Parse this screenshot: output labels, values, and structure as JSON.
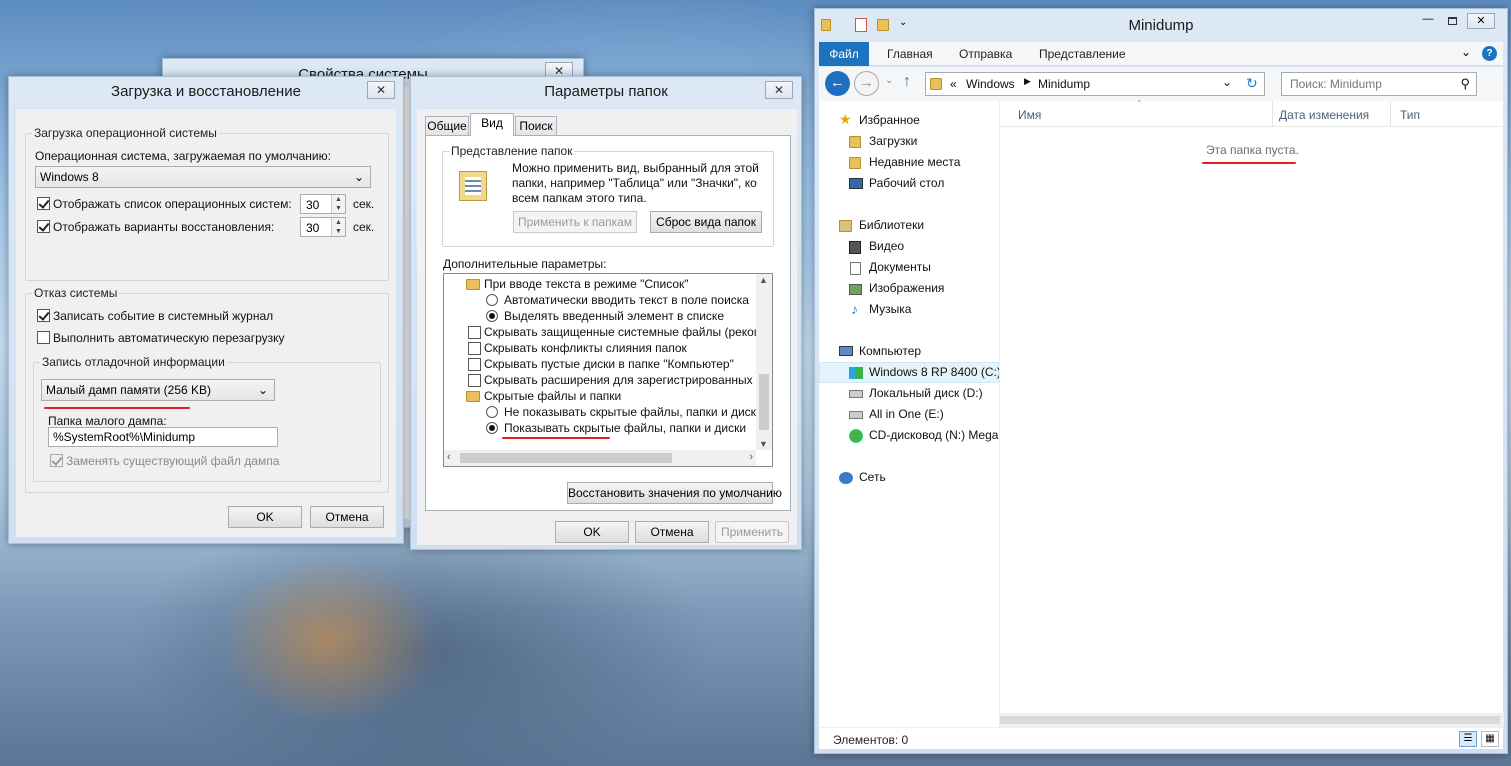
{
  "sysprops": {
    "title": "Свойства системы"
  },
  "boot": {
    "title": "Загрузка и восстановление",
    "os_group": "Загрузка операционной системы",
    "default_os_label": "Операционная система, загружаемая по умолчанию:",
    "default_os_value": "Windows 8",
    "show_os_list_label": "Отображать список операционных систем:",
    "show_os_list_value": "30",
    "show_recovery_label": "Отображать варианты восстановления:",
    "show_recovery_value": "30",
    "sec": "сек.",
    "failure_group": "Отказ системы",
    "write_event_label": "Записать событие в системный журнал",
    "auto_restart_label": "Выполнить автоматическую перезагрузку",
    "debug_group": "Запись отладочной информации",
    "dump_type": "Малый дамп памяти (256 KB)",
    "dump_folder_label": "Папка малого дампа:",
    "dump_folder_value": "%SystemRoot%\\Minidump",
    "overwrite_label": "Заменять существующий файл дампа",
    "ok": "OK",
    "cancel": "Отмена"
  },
  "folder": {
    "title": "Параметры папок",
    "tabs": [
      "Общие",
      "Вид",
      "Поиск"
    ],
    "view_group": "Представление папок",
    "view_text": [
      "Можно применить вид, выбранный для этой",
      "папки, например \"Таблица\" или \"Значки\", ко",
      "всем папкам этого типа."
    ],
    "apply_folders": "Применить к папкам",
    "reset_folders": "Сброс вида папок",
    "advanced_label": "Дополнительные параметры:",
    "items": [
      "При вводе текста в режиме \"Список\"",
      "Автоматически вводить текст в поле поиска",
      "Выделять введенный элемент в списке",
      "Скрывать защищенные системные файлы (рекомен,",
      "Скрывать конфликты слияния папок",
      "Скрывать пустые диски в папке \"Компьютер\"",
      "Скрывать расширения для зарегистрированных типо",
      "Скрытые файлы и папки",
      "Не показывать скрытые файлы, папки и диски",
      "Показывать скрытые файлы, папки и диски"
    ],
    "restore_defaults": "Восстановить значения по умолчанию",
    "ok": "OK",
    "cancel": "Отмена",
    "apply": "Применить"
  },
  "explorer": {
    "title": "Minidump",
    "ribbon_tabs": [
      "Файл",
      "Главная",
      "Отправка",
      "Представление"
    ],
    "breadcrumb": [
      "«",
      "Windows",
      "Minidump"
    ],
    "search_placeholder": "Поиск: Minidump",
    "columns": [
      "Имя",
      "Дата изменения",
      "Тип"
    ],
    "empty_text": "Эта папка пуста.",
    "nav": {
      "favorites": "Избранное",
      "downloads": "Загрузки",
      "recent": "Недавние места",
      "desktop": "Рабочий стол",
      "libraries": "Библиотеки",
      "video": "Видео",
      "documents": "Документы",
      "pictures": "Изображения",
      "music": "Музыка",
      "computer": "Компьютер",
      "drive_c": "Windows 8 RP 8400 (C:)",
      "drive_d": "Локальный диск (D:)",
      "drive_e": "All in One (E:)",
      "drive_n": "CD-дисковод (N:) Mega",
      "network": "Сеть"
    },
    "status": "Элементов: 0",
    "accent_color": "#1e73be"
  }
}
